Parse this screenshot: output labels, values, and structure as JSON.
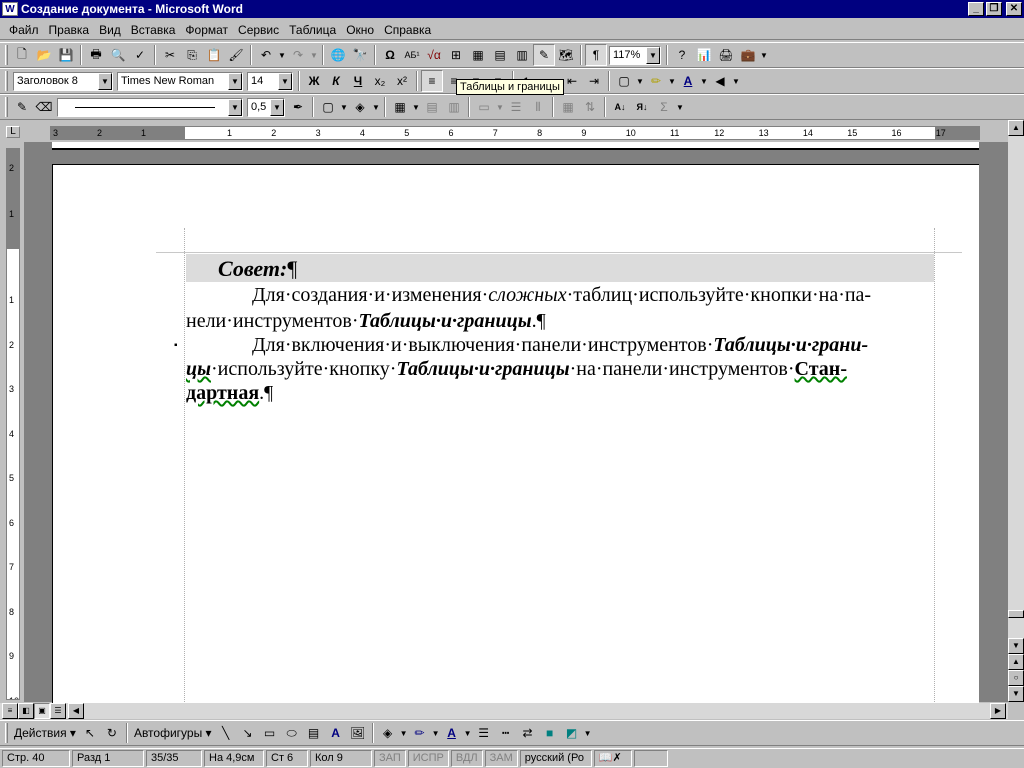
{
  "window": {
    "title": "Создание документа - Microsoft Word",
    "icon": "W",
    "min": "_",
    "restore": "❐",
    "close": "✕"
  },
  "menu": [
    {
      "label": "Файл"
    },
    {
      "label": "Правка"
    },
    {
      "label": "Вид"
    },
    {
      "label": "Вставка"
    },
    {
      "label": "Формат"
    },
    {
      "label": "Сервис"
    },
    {
      "label": "Таблица"
    },
    {
      "label": "Окно"
    },
    {
      "label": "Справка"
    }
  ],
  "standard": {
    "zoom": "117%"
  },
  "formatting": {
    "style": "Заголовок 8",
    "font": "Times New Roman",
    "size": "14",
    "bold": "Ж",
    "italic": "К",
    "underline": "Ч"
  },
  "tables_toolbar": {
    "line_weight": "0,5",
    "sigma": "Σ"
  },
  "tooltip": "Таблицы и границы",
  "ruler": {
    "h_numbers": [
      "3",
      "2",
      "1",
      "1",
      "2",
      "3",
      "4",
      "5",
      "6",
      "7",
      "8",
      "9",
      "10",
      "11",
      "12",
      "13",
      "14",
      "15",
      "16",
      "17"
    ],
    "v_numbers": [
      "2",
      "1",
      "1",
      "2",
      "3",
      "4",
      "5",
      "6",
      "7",
      "8",
      "9",
      "10"
    ]
  },
  "document": {
    "heading": "Совет:",
    "pilcrow": "¶",
    "p1": {
      "l1a": "Для·создания·и·изменения·",
      "l1b": "сложных",
      "l1c": "·таблиц·используйте·кнопки·на·па-",
      "l2a": "нели·инструментов·",
      "l2b": "Таблицы·и·границы",
      "l2c": "."
    },
    "p2": {
      "l1a": "Для·включения·и·выключения·панели·инструментов·",
      "l1b": "Таблицы·и·грани-",
      "l2a": "цы",
      "l2b": "·используйте·кнопку·",
      "l2c": "Таблицы·и·границы",
      "l2d": "·на·панели·инструментов·",
      "l2e": "Стан-",
      "l3a": "дартная",
      "l3b": "."
    },
    "bullet": "▪"
  },
  "drawing": {
    "actions": "Действия",
    "autoshapes": "Автофигуры"
  },
  "status": {
    "page": "Стр. 40",
    "section": "Разд 1",
    "pages": "35/35",
    "at": "На 4,9см",
    "line": "Ст 6",
    "col": "Кол 9",
    "rec": "ЗАП",
    "trk": "ИСПР",
    "ext": "ВДЛ",
    "ovr": "ЗАМ",
    "lang": "русский (Ро"
  }
}
